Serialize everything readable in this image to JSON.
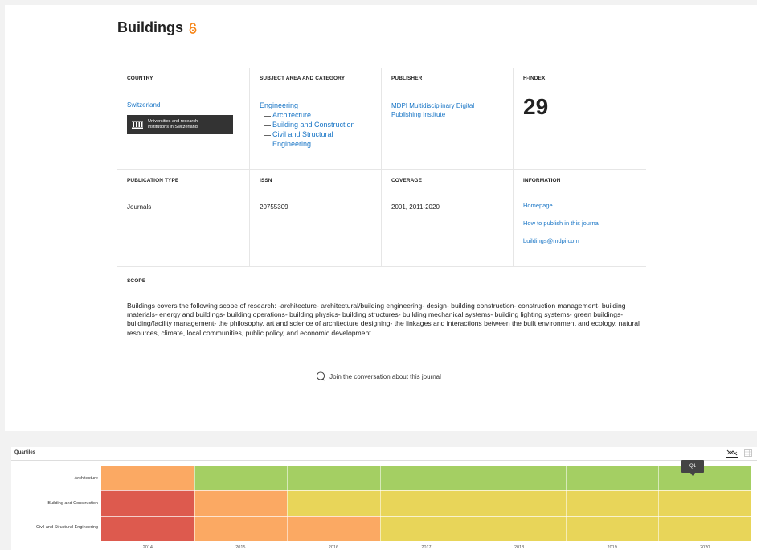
{
  "journal": {
    "title": "Buildings"
  },
  "labels": {
    "country": "COUNTRY",
    "subject": "SUBJECT AREA AND CATEGORY",
    "publisher": "PUBLISHER",
    "hindex": "H-INDEX",
    "pubtype": "PUBLICATION TYPE",
    "issn": "ISSN",
    "coverage": "COVERAGE",
    "information": "INFORMATION",
    "scope": "SCOPE"
  },
  "country": {
    "name": "Switzerland",
    "badge": [
      "Universities and research",
      "institutions in Switzerland"
    ]
  },
  "subject": {
    "area": "Engineering",
    "categories": [
      "Architecture",
      "Building and Construction",
      "Civil and Structural",
      "Engineering"
    ]
  },
  "publisher": {
    "lines": [
      "MDPI Multidisciplinary Digital",
      "Publishing Institute"
    ]
  },
  "hindex": "29",
  "pubtype": "Journals",
  "issn": "20755309",
  "coverage": "2001, 2011-2020",
  "information": {
    "homepage": "Homepage",
    "howto": "How to publish in this journal",
    "email": "buildings@mdpi.com"
  },
  "scope_text": "Buildings covers the following scope of research: -architecture- architectural/building engineering- design- building construction- construction management- building materials- energy and buildings- building operations- building physics- building structures- building mechanical systems- building lighting systems- green buildings- building/facility management- the philosophy, art and science of architecture designing- the linkages and interactions between the built environment and ecology, natural resources, climate, local communities, public policy, and economic development.",
  "join_text": "Join the conversation about this journal",
  "quartiles": {
    "title": "Quartiles",
    "tooltip": "Q1",
    "colors": {
      "Q1": "#a4cf63",
      "Q2": "#e8d559",
      "Q3": "#fba963",
      "Q4": "#dd5a4e"
    }
  },
  "chart_data": {
    "type": "heatmap",
    "title": "Quartiles",
    "categories": [
      "Architecture",
      "Building and Construction",
      "Civil and Structural Engineering"
    ],
    "x": [
      "2014",
      "2015",
      "2016",
      "2017",
      "2018",
      "2019",
      "2020"
    ],
    "series": [
      {
        "name": "Architecture",
        "values": [
          "Q3",
          "Q1",
          "Q1",
          "Q1",
          "Q1",
          "Q1",
          "Q1"
        ]
      },
      {
        "name": "Building and Construction",
        "values": [
          "Q4",
          "Q3",
          "Q2",
          "Q2",
          "Q2",
          "Q2",
          "Q2"
        ]
      },
      {
        "name": "Civil and Structural Engineering",
        "values": [
          "Q4",
          "Q3",
          "Q3",
          "Q2",
          "Q2",
          "Q2",
          "Q2"
        ]
      }
    ]
  }
}
